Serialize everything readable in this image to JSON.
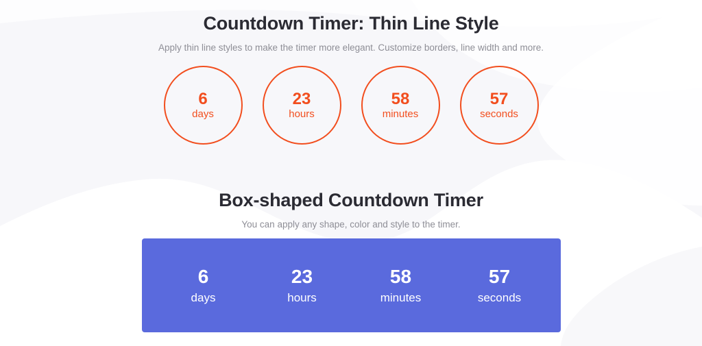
{
  "page": {
    "background_color": "#f7f7fa",
    "wave_color": "#fdfdfe"
  },
  "sections": [
    {
      "id": "thin-line",
      "title": "Countdown Timer: Thin Line Style",
      "subtitle": "Apply thin line styles to make the timer more elegant. Customize borders, line width and more.",
      "style": "circle-outline",
      "accent_color": "#f24e1e",
      "units": [
        {
          "value": "6",
          "label": "days"
        },
        {
          "value": "23",
          "label": "hours"
        },
        {
          "value": "58",
          "label": "minutes"
        },
        {
          "value": "57",
          "label": "seconds"
        }
      ]
    },
    {
      "id": "box-shaped",
      "title": "Box-shaped Countdown Timer",
      "subtitle": "You can apply any shape, color and style to the timer.",
      "style": "filled-box",
      "accent_color": "#5a6add",
      "text_color": "#ffffff",
      "units": [
        {
          "value": "6",
          "label": "days"
        },
        {
          "value": "23",
          "label": "hours"
        },
        {
          "value": "58",
          "label": "minutes"
        },
        {
          "value": "57",
          "label": "seconds"
        }
      ]
    }
  ]
}
